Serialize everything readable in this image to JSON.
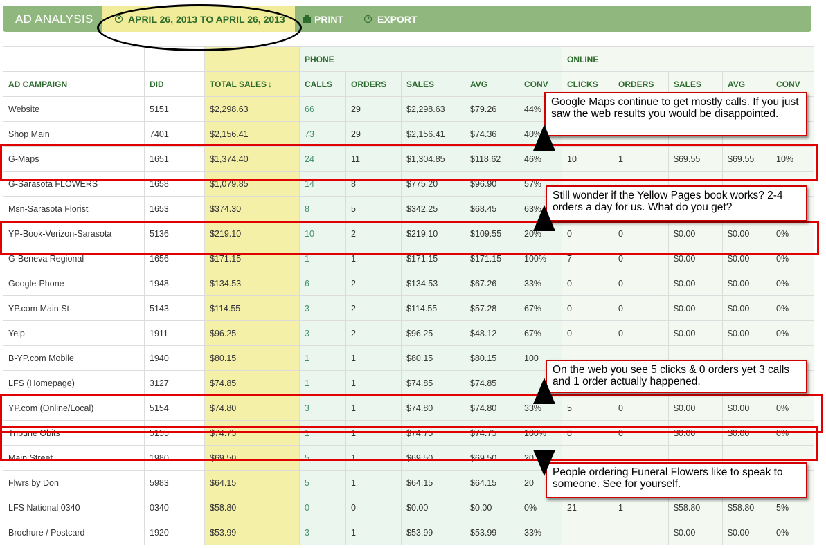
{
  "header": {
    "title": "AD ANALYSIS",
    "date_range": "APRIL 26, 2013 TO APRIL 26, 2013",
    "print_label": "PRINT",
    "export_label": "EXPORT"
  },
  "groups": {
    "phone": "PHONE",
    "online": "ONLINE"
  },
  "columns": [
    "AD CAMPAIGN",
    "DID",
    "TOTAL SALES",
    "CALLS",
    "ORDERS",
    "SALES",
    "AVG",
    "CONV",
    "CLICKS",
    "ORDERS",
    "SALES",
    "AVG",
    "CONV"
  ],
  "sort_indicator": "↓",
  "rows": [
    [
      "Website",
      "5151",
      "$2,298.63",
      "66",
      "29",
      "$2,298.63",
      "$79.26",
      "44%",
      "",
      "",
      "",
      "",
      ""
    ],
    [
      "Shop Main",
      "7401",
      "$2,156.41",
      "73",
      "29",
      "$2,156.41",
      "$74.36",
      "40%",
      "",
      "",
      "",
      "",
      ""
    ],
    [
      "G-Maps",
      "1651",
      "$1,374.40",
      "24",
      "11",
      "$1,304.85",
      "$118.62",
      "46%",
      "10",
      "1",
      "$69.55",
      "$69.55",
      "10%"
    ],
    [
      "G-Sarasota FLOWERS",
      "1658",
      "$1,079.85",
      "14",
      "8",
      "$775.20",
      "$96.90",
      "57%",
      "",
      "",
      "",
      "",
      ""
    ],
    [
      "Msn-Sarasota Florist",
      "1653",
      "$374.30",
      "8",
      "5",
      "$342.25",
      "$68.45",
      "63%",
      "",
      "",
      "",
      "",
      ""
    ],
    [
      "YP-Book-Verizon-Sarasota",
      "5136",
      "$219.10",
      "10",
      "2",
      "$219.10",
      "$109.55",
      "20%",
      "0",
      "0",
      "$0.00",
      "$0.00",
      "0%"
    ],
    [
      "G-Beneva Regional",
      "1656",
      "$171.15",
      "1",
      "1",
      "$171.15",
      "$171.15",
      "100%",
      "7",
      "0",
      "$0.00",
      "$0.00",
      "0%"
    ],
    [
      "Google-Phone",
      "1948",
      "$134.53",
      "6",
      "2",
      "$134.53",
      "$67.26",
      "33%",
      "0",
      "0",
      "$0.00",
      "$0.00",
      "0%"
    ],
    [
      "YP.com Main St",
      "5143",
      "$114.55",
      "3",
      "2",
      "$114.55",
      "$57.28",
      "67%",
      "0",
      "0",
      "$0.00",
      "$0.00",
      "0%"
    ],
    [
      "Yelp",
      "1911",
      "$96.25",
      "3",
      "2",
      "$96.25",
      "$48.12",
      "67%",
      "0",
      "0",
      "$0.00",
      "$0.00",
      "0%"
    ],
    [
      "B-YP.com Mobile",
      "1940",
      "$80.15",
      "1",
      "1",
      "$80.15",
      "$80.15",
      "100",
      "",
      "",
      "",
      "",
      ""
    ],
    [
      "LFS (Homepage)",
      "3127",
      "$74.85",
      "1",
      "1",
      "$74.85",
      "$74.85",
      "",
      "",
      "",
      "",
      "",
      ""
    ],
    [
      "YP.com (Online/Local)",
      "5154",
      "$74.80",
      "3",
      "1",
      "$74.80",
      "$74.80",
      "33%",
      "5",
      "0",
      "$0.00",
      "$0.00",
      "0%"
    ],
    [
      "Tribune Obits",
      "5155",
      "$74.75",
      "1",
      "1",
      "$74.75",
      "$74.75",
      "100%",
      "8",
      "0",
      "$0.00",
      "$0.00",
      "0%"
    ],
    [
      "Main Street",
      "1980",
      "$69.50",
      "5",
      "1",
      "$69.50",
      "$69.50",
      "20",
      "",
      "",
      "",
      "",
      ""
    ],
    [
      "Flwrs by Don",
      "5983",
      "$64.15",
      "5",
      "1",
      "$64.15",
      "$64.15",
      "20",
      "",
      "",
      "",
      "",
      ""
    ],
    [
      "LFS National 0340",
      "0340",
      "$58.80",
      "0",
      "0",
      "$0.00",
      "$0.00",
      "0%",
      "21",
      "1",
      "$58.80",
      "$58.80",
      "5%"
    ],
    [
      "Brochure / Postcard",
      "1920",
      "$53.99",
      "3",
      "1",
      "$53.99",
      "$53.99",
      "33%",
      "",
      "",
      "$0.00",
      "$0.00",
      "0%"
    ]
  ],
  "callouts": [
    "Google Maps continue to get mostly calls. If you just saw the web results you would be disappointed.",
    "Still wonder if the Yellow Pages book works? 2-4 orders a day for us. What do you get?",
    "On the web you see 5 clicks & 0 orders yet 3 calls and 1 order actually happened.",
    "People ordering Funeral Flowers like to speak  to someone. See for yourself."
  ],
  "colors": {
    "header_bar": "#8fb77e",
    "date_highlight": "#f0ec9a",
    "total_sales_col": "#f5f0a8",
    "annotation_red": "#e00000"
  }
}
